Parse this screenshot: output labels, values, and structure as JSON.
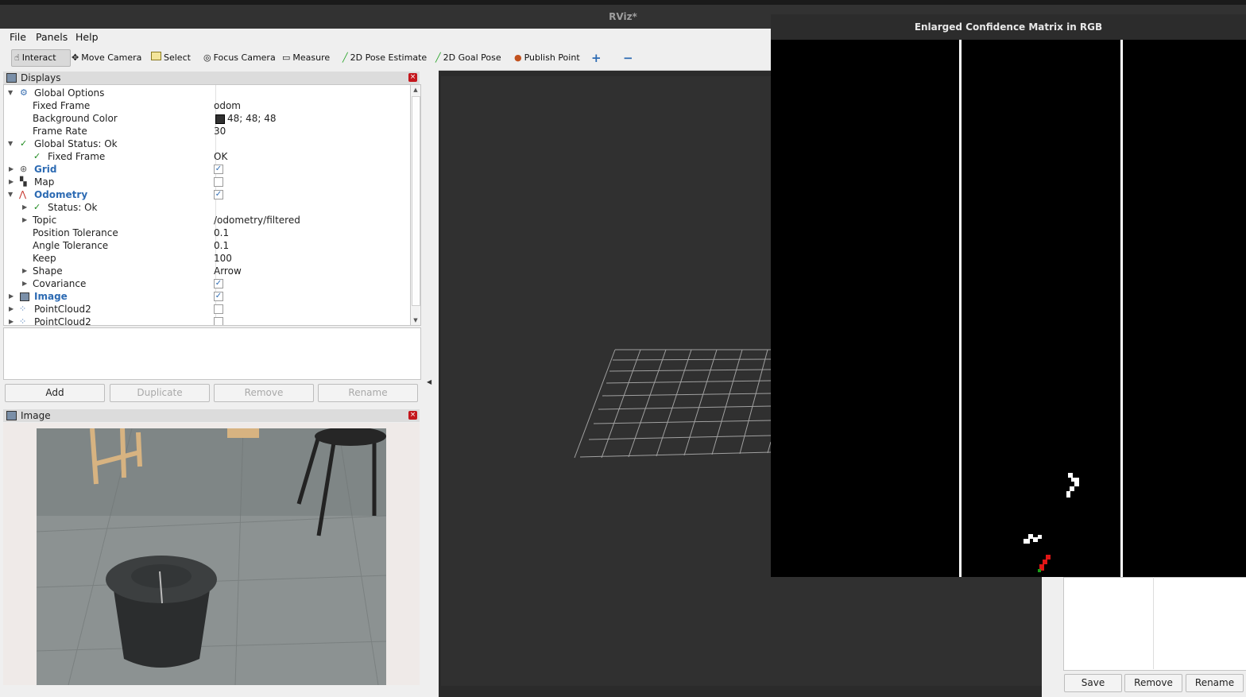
{
  "window": {
    "title": "RViz*"
  },
  "menu": [
    "File",
    "Panels",
    "Help"
  ],
  "toolbar": {
    "interact": "Interact",
    "move_camera": "Move Camera",
    "select": "Select",
    "focus_camera": "Focus Camera",
    "measure": "Measure",
    "pose_estimate": "2D Pose Estimate",
    "goal_pose": "2D Goal Pose",
    "publish_point": "Publish Point",
    "plus_icon": "+",
    "minus_icon": "−"
  },
  "displays": {
    "title": "Displays",
    "rows": {
      "global_options": "Global Options",
      "fixed_frame": "Fixed Frame",
      "fixed_frame_val": "odom",
      "background_color": "Background Color",
      "background_color_val": "48; 48; 48",
      "frame_rate": "Frame Rate",
      "frame_rate_val": "30",
      "global_status": "Global Status: Ok",
      "fixed_frame_status": "Fixed Frame",
      "fixed_frame_status_val": "OK",
      "grid": "Grid",
      "map": "Map",
      "odometry": "Odometry",
      "status_ok": "Status: Ok",
      "topic": "Topic",
      "topic_val": "/odometry/filtered",
      "position_tolerance": "Position Tolerance",
      "position_tolerance_val": "0.1",
      "angle_tolerance": "Angle Tolerance",
      "angle_tolerance_val": "0.1",
      "keep": "Keep",
      "keep_val": "100",
      "shape": "Shape",
      "shape_val": "Arrow",
      "covariance": "Covariance",
      "image": "Image",
      "pointcloud2_a": "PointCloud2",
      "pointcloud2_b": "PointCloud2"
    },
    "buttons": {
      "add": "Add",
      "duplicate": "Duplicate",
      "remove": "Remove",
      "rename": "Rename"
    }
  },
  "image_panel": {
    "title": "Image"
  },
  "confidence_window": {
    "title": "Enlarged Confidence Matrix in RGB"
  },
  "views_buttons": {
    "save": "Save",
    "remove": "Remove",
    "rename": "Rename"
  },
  "colors": {
    "background": "#303030",
    "accent": "#2d6bb3",
    "status_ok": "#1e8a1e",
    "close": "#c4161c"
  }
}
